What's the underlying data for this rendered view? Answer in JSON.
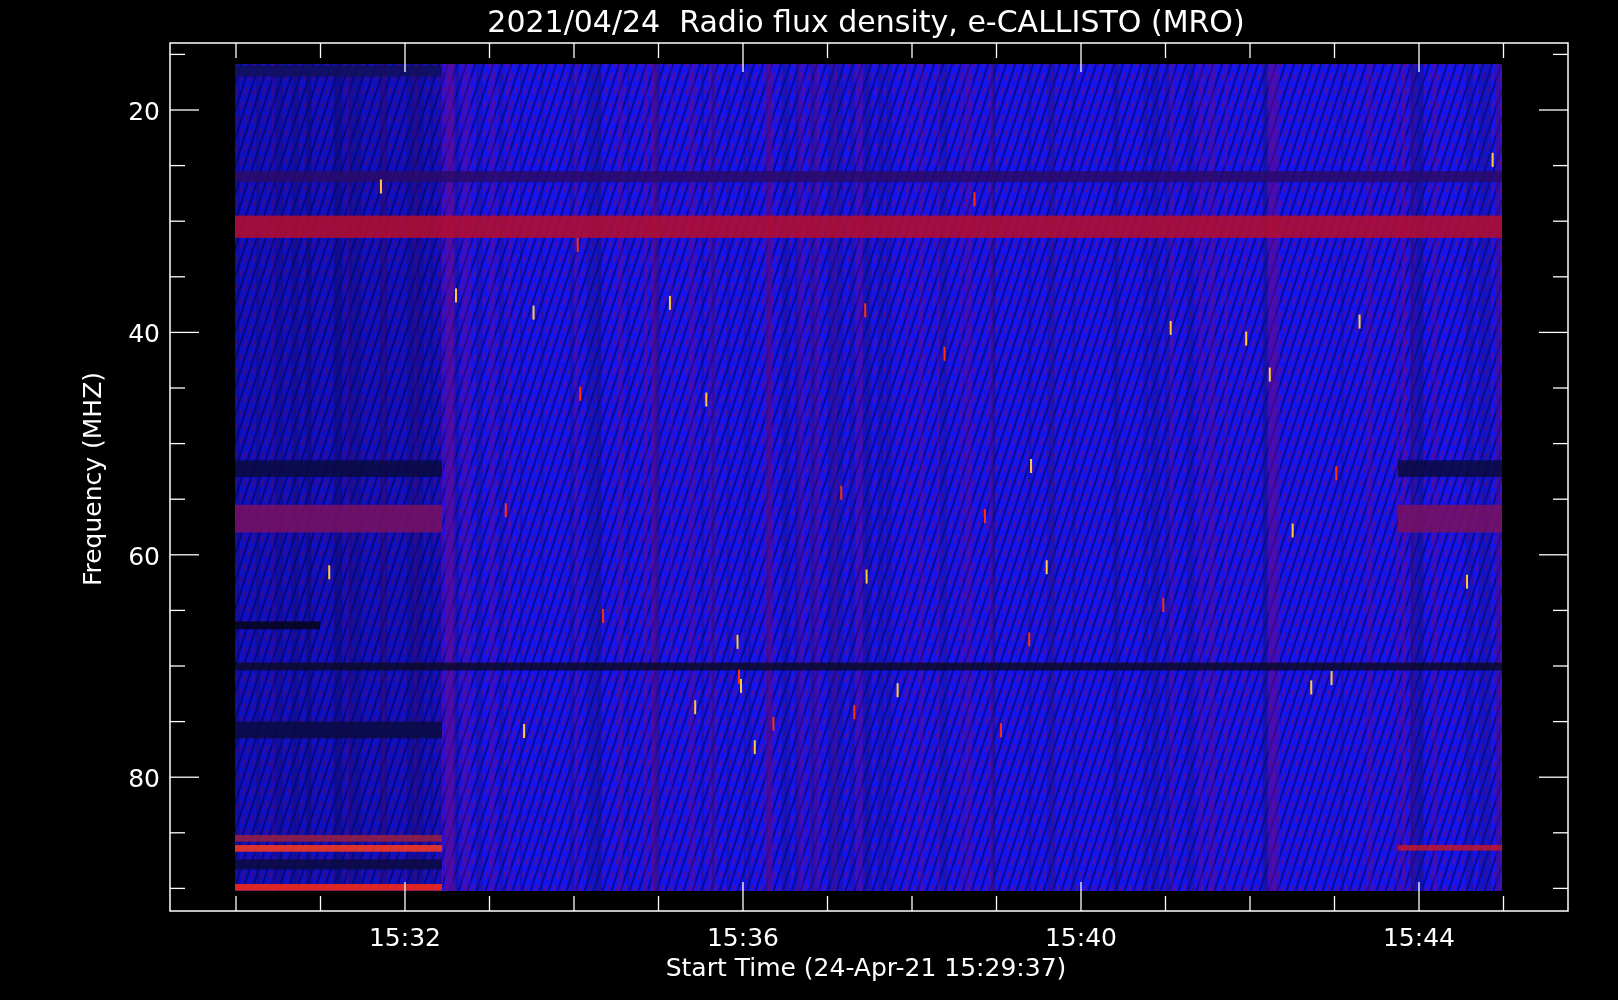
{
  "title": "2021/04/24  Radio flux density, e-CALLISTO (MRO)",
  "y_axis": {
    "label": "Frequency (MHZ)",
    "ticks": [
      "20",
      "40",
      "60",
      "80"
    ]
  },
  "x_axis": {
    "label": "Start Time (24-Apr-21 15:29:37)",
    "ticks": [
      "15:32",
      "15:36",
      "15:40",
      "15:44"
    ]
  }
}
